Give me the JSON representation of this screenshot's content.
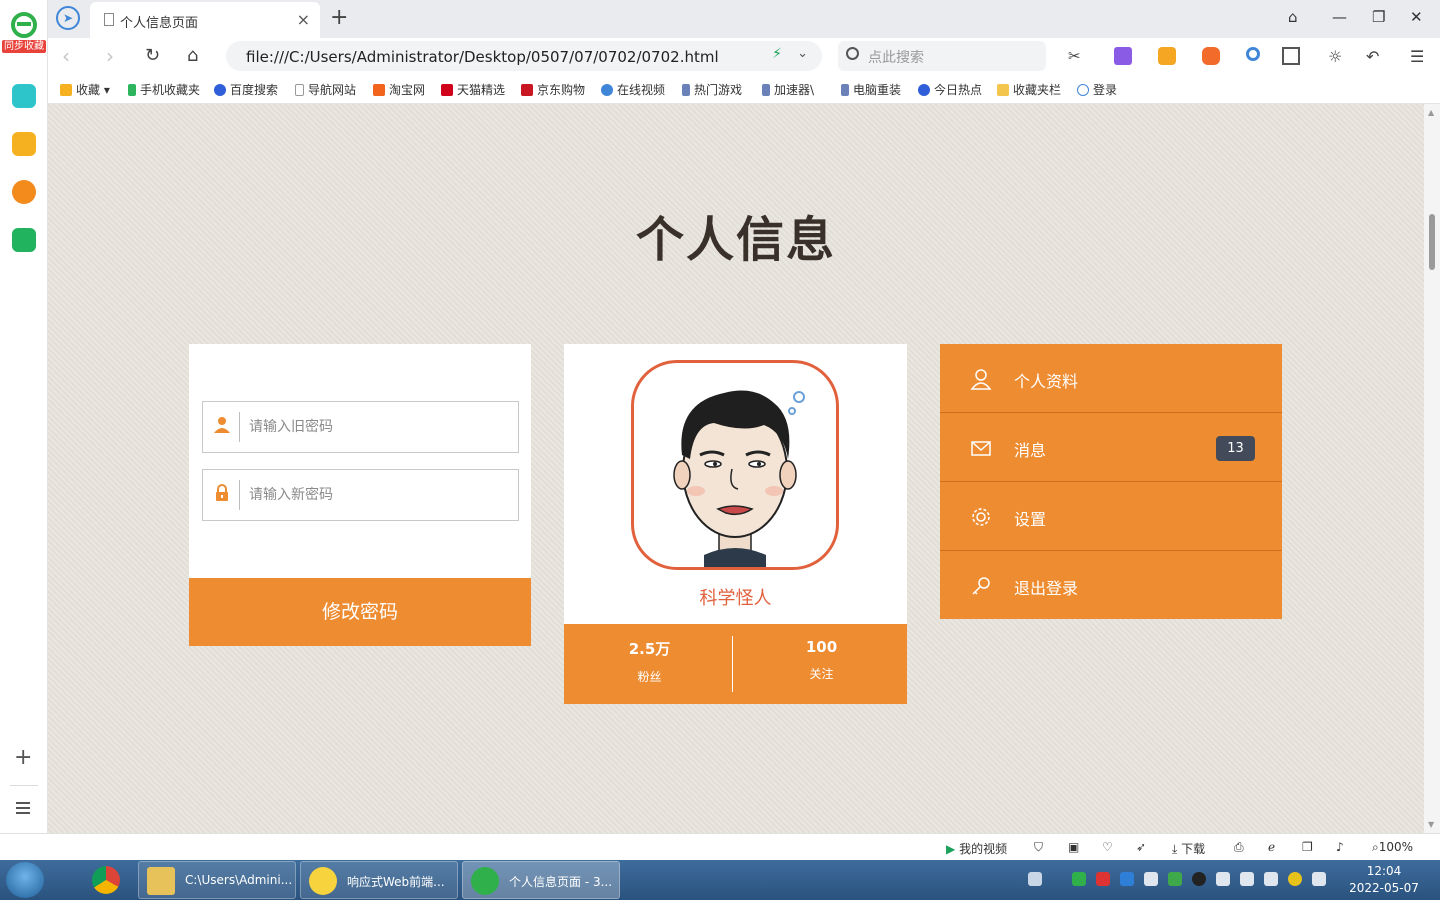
{
  "browser": {
    "tab_title": "个人信息页面",
    "url": "file:///C:/Users/Administrator/Desktop/0507/07/0702/0702.html",
    "search_placeholder": "点此搜索",
    "sync_label": "同步收藏",
    "bookmarks": [
      "收藏",
      "手机收藏夹",
      "百度搜索",
      "导航网站",
      "淘宝网",
      "天猫精选",
      "京东购物",
      "在线视频",
      "热门游戏",
      "加速器\\",
      "电脑重装",
      "今日热点",
      "收藏夹栏",
      "登录"
    ]
  },
  "page": {
    "title": "个人信息",
    "password_form": {
      "old_placeholder": "请输入旧密码",
      "new_placeholder": "请输入新密码",
      "submit_label": "修改密码"
    },
    "profile": {
      "name": "科学怪人",
      "stats": [
        {
          "value": "2.5万",
          "label": "粉丝"
        },
        {
          "value": "100",
          "label": "关注"
        }
      ]
    },
    "menu": [
      {
        "label": "个人资料",
        "icon": "user-icon"
      },
      {
        "label": "消息",
        "icon": "mail-icon",
        "badge": "13"
      },
      {
        "label": "设置",
        "icon": "gear-icon"
      },
      {
        "label": "退出登录",
        "icon": "key-icon"
      }
    ]
  },
  "statusbar": {
    "my_video": "我的视频",
    "download": "下载",
    "zoom": "100%"
  },
  "taskbar": {
    "items": [
      "C:\\Users\\Admini...",
      "响应式Web前端...",
      "个人信息页面 - 3..."
    ],
    "time": "12:04",
    "date": "2022-05-07"
  },
  "colors": {
    "accent": "#ee8c32",
    "avatar_border": "#e2613d",
    "badge_bg": "#434a5a",
    "page_bg": "#e6e2db"
  }
}
